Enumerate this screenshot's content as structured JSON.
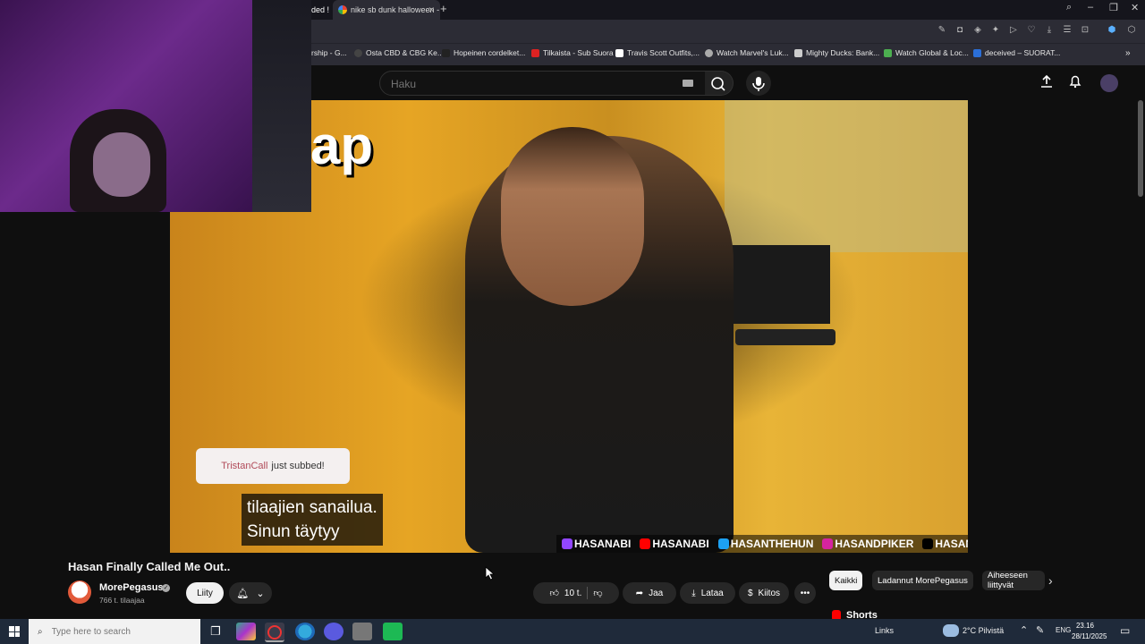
{
  "browser": {
    "tabs": [
      {
        "label": "ded !",
        "active": false
      },
      {
        "label": "nike sb dunk halloween -",
        "active": true
      }
    ],
    "new_tab_label": "+",
    "bookmarks": [
      "rship - G...",
      "Osta CBD & CBG Ke...",
      "Hopeinen cordelket...",
      "Tilkaista - Sub Suora",
      "Travis Scott Outfits,...",
      "Watch Marvel's Luk...",
      "Mighty Ducks: Bank...",
      "Watch Global & Loc...",
      "deceived – SUORAT..."
    ]
  },
  "youtube": {
    "search": {
      "placeholder": "Haku"
    },
    "video": {
      "overlay_text": "ap",
      "sub_toast": {
        "user": "TristanCall",
        "text": "just subbed!"
      },
      "caption_lines": [
        "tilaajien sanailua.",
        "Sinun täytyy"
      ],
      "socials": [
        "HASANABI",
        "HASANABI",
        "HASANTHEHUN",
        "HASANDPIKER",
        "HASANDPIKER"
      ]
    },
    "title": "Hasan Finally Called Me Out..",
    "channel": {
      "name": "MorePegasus",
      "subscribers": "766 t. tilaajaa"
    },
    "buttons": {
      "join": "Liity",
      "likes": "10 t.",
      "share": "Jaa",
      "download": "Lataa",
      "thanks": "Kiitos"
    },
    "chips": [
      "Kaikki",
      "Ladannut MorePegasus",
      "Aiheeseen liittyvät"
    ],
    "shorts_label": "Shorts"
  },
  "taskbar": {
    "search_placeholder": "Type here to search",
    "links_label": "Links",
    "weather": "2°C Pilvistä",
    "language": "ENG",
    "time": "23.16",
    "date": "28/11/2025"
  }
}
